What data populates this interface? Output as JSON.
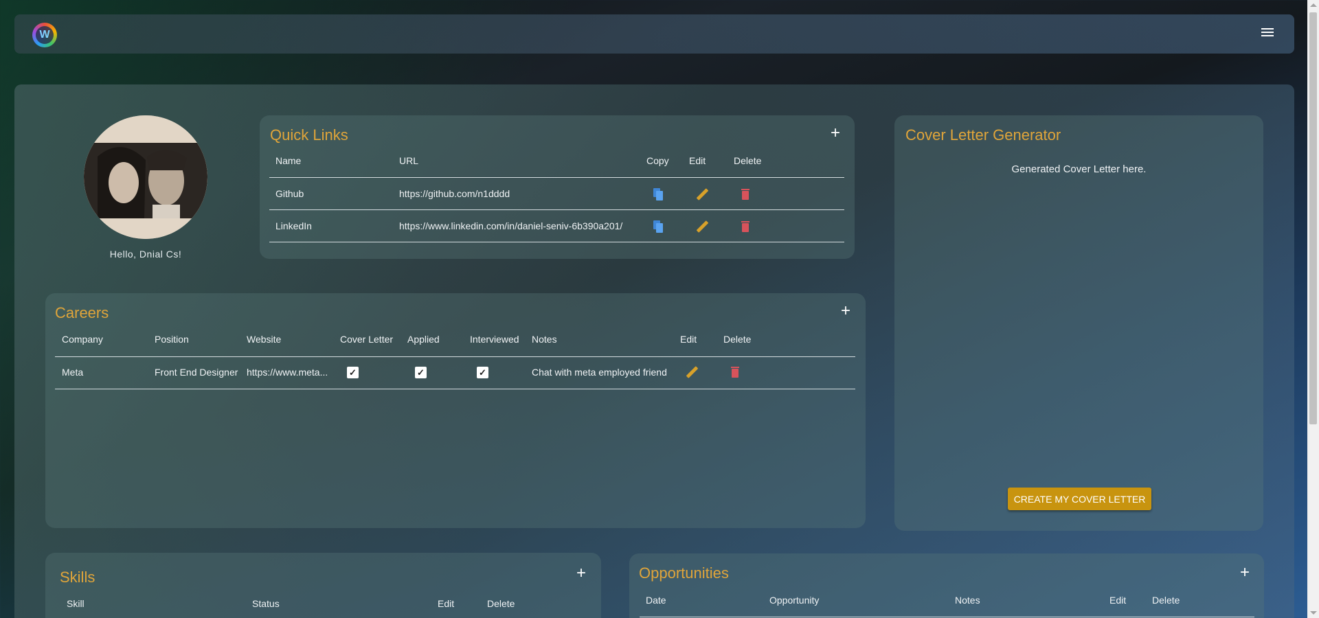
{
  "header": {
    "logo_icon": "waveform-logo-icon",
    "menu_icon": "hamburger-menu-icon"
  },
  "profile": {
    "greeting": "Hello, Dnial Cs!"
  },
  "quick_links": {
    "title": "Quick Links",
    "add": "+",
    "columns": [
      "Name",
      "URL",
      "Copy",
      "Edit",
      "Delete"
    ],
    "rows": [
      {
        "name": "Github",
        "url": "https://github.com/n1dddd"
      },
      {
        "name": "LinkedIn",
        "url": "https://www.linkedin.com/in/daniel-seniv-6b390a201/"
      }
    ]
  },
  "cover_letter": {
    "title": "Cover Letter Generator",
    "output": "Generated Cover Letter here.",
    "button": "CREATE MY COVER LETTER"
  },
  "careers": {
    "title": "Careers",
    "add": "+",
    "columns": [
      "Company",
      "Position",
      "Website",
      "Cover Letter",
      "Applied",
      "Interviewed",
      "Notes",
      "Edit",
      "Delete"
    ],
    "rows": [
      {
        "company": "Meta",
        "position": "Front End Designer",
        "website": "https://www.meta...",
        "cover_letter": true,
        "applied": true,
        "interviewed": true,
        "notes": "Chat with meta employed friend"
      }
    ]
  },
  "skills": {
    "title": "Skills",
    "add": "+",
    "columns": [
      "Skill",
      "Status",
      "Edit",
      "Delete"
    ]
  },
  "opportunities": {
    "title": "Opportunities",
    "add": "+",
    "columns": [
      "Date",
      "Opportunity",
      "Notes",
      "Edit",
      "Delete"
    ]
  },
  "colors": {
    "accent": "#e0a53a",
    "button": "#c8940f",
    "copy": "#3f86d6",
    "edit": "#d8a12a",
    "delete": "#d8535b"
  }
}
